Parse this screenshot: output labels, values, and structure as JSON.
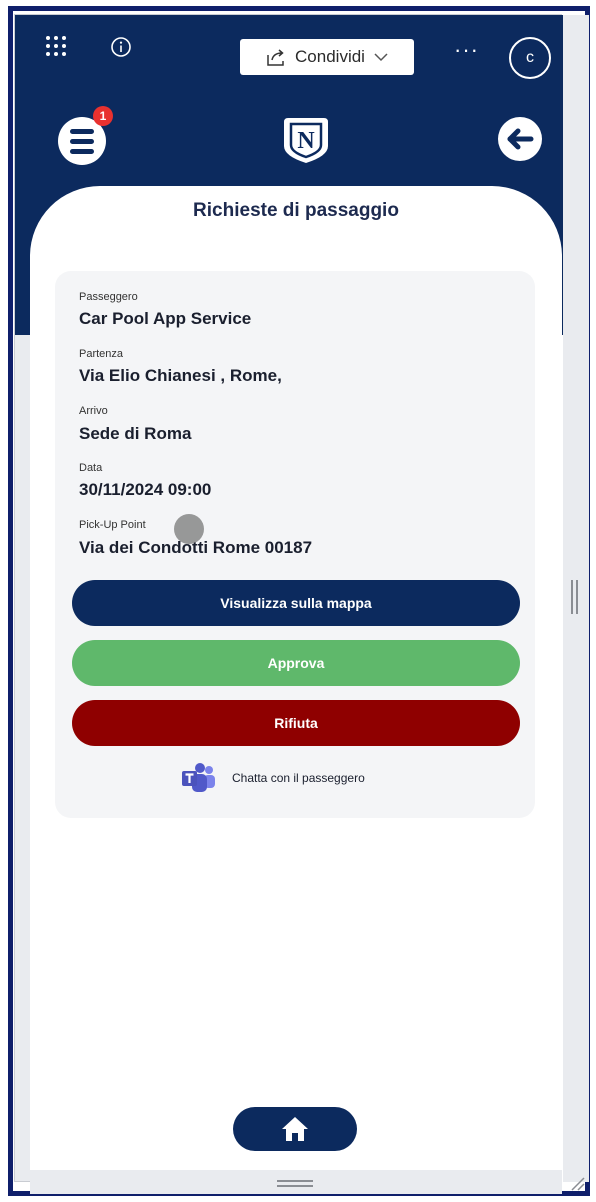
{
  "topbar": {
    "share_label": "Condividi",
    "more_label": "···",
    "avatar_initial": "c"
  },
  "header": {
    "notification_count": "1",
    "logo_letter": "N"
  },
  "page": {
    "title": "Richieste di passaggio"
  },
  "request": {
    "fields": [
      {
        "label": "Passeggero",
        "value": "Car Pool App Service"
      },
      {
        "label": "Partenza",
        "value": "Via Elio Chianesi , Rome,"
      },
      {
        "label": "Arrivo",
        "value": "Sede di Roma"
      },
      {
        "label": "Data",
        "value": "30/11/2024 09:00"
      },
      {
        "label": "Pick-Up Point",
        "value": "Via dei Condotti  Rome 00187"
      }
    ],
    "buttons": {
      "map": "Visualizza sulla mappa",
      "approve": "Approva",
      "reject": "Rifiuta"
    },
    "chat_label": "Chatta con il passeggero"
  },
  "colors": {
    "primary": "#0c2a5e",
    "approve": "#5fb86b",
    "reject": "#8f0000",
    "badge": "#e8312f"
  },
  "icons": [
    "apps-grid-icon",
    "info-icon",
    "share-icon",
    "chevron-down-icon",
    "more-icon",
    "menu-icon",
    "logo-icon",
    "back-arrow-icon",
    "teams-icon",
    "home-icon"
  ]
}
